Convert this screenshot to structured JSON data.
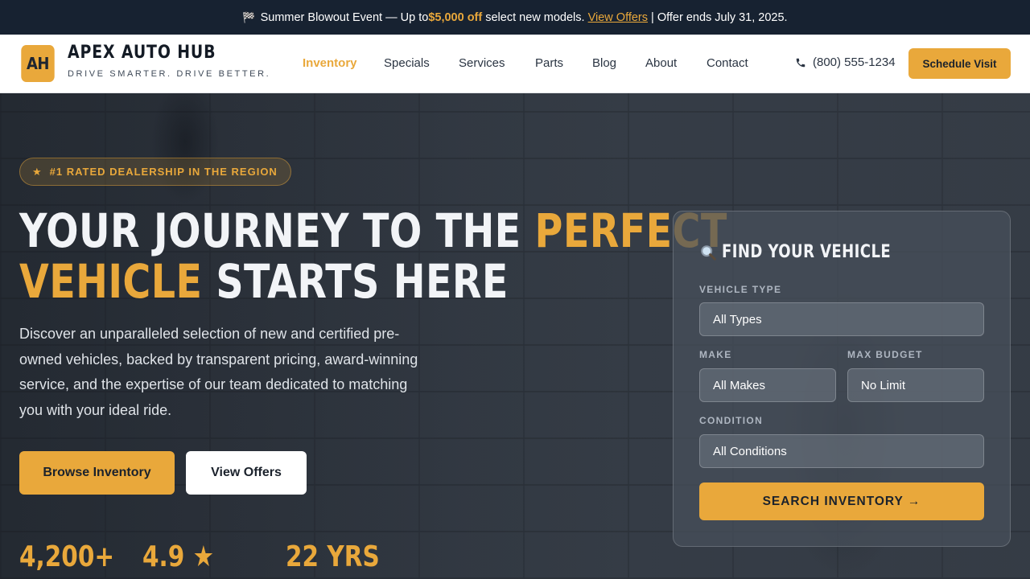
{
  "announcement": {
    "icon": "checkered-flag-icon",
    "prefix": "Summer Blowout Event — Up to ",
    "highlight": "$5,000 off",
    "middle": " select new models. ",
    "link": "View Offers",
    "suffix": " | Offer ends July 31, 2025."
  },
  "header": {
    "logo_initials": "AH",
    "brand_name": "APEX AUTO HUB",
    "tagline": "DRIVE SMARTER. DRIVE BETTER.",
    "nav": [
      {
        "label": "Inventory",
        "active": true
      },
      {
        "label": "Specials",
        "active": false
      },
      {
        "label": "Services",
        "active": false
      },
      {
        "label": "Parts",
        "active": false
      },
      {
        "label": "Blog",
        "active": false
      },
      {
        "label": "About",
        "active": false
      },
      {
        "label": "Contact",
        "active": false
      }
    ],
    "phone": "(800) 555-1234",
    "cta": "Schedule Visit"
  },
  "hero": {
    "badge": "#1 RATED DEALERSHIP IN THE REGION",
    "headline_part1": "YOUR JOURNEY TO THE ",
    "headline_gold1": "PERFECT",
    "headline_gold2": "VEHICLE",
    "headline_part2": " STARTS HERE",
    "description": "Discover an unparalleled selection of new and certified pre-owned vehicles, backed by transparent pricing, award-winning service, and the expertise of our team dedicated to matching you with your ideal ride.",
    "primary_button": "Browse Inventory",
    "secondary_button": "View Offers",
    "stats": [
      "4,200+",
      "4.9 ★",
      "22 YRS"
    ]
  },
  "search_panel": {
    "title": "FIND YOUR VEHICLE",
    "title_icon": "magnifier-icon",
    "vehicle_type_label": "VEHICLE TYPE",
    "vehicle_type_value": "All Types",
    "make_label": "MAKE",
    "make_value": "All Makes",
    "budget_label": "MAX BUDGET",
    "budget_value": "No Limit",
    "condition_label": "CONDITION",
    "condition_value": "All Conditions",
    "search_button": "SEARCH INVENTORY →"
  },
  "colors": {
    "accent": "#e9a83b",
    "announcement_bg": "#172231",
    "header_bg": "#ffffff"
  }
}
